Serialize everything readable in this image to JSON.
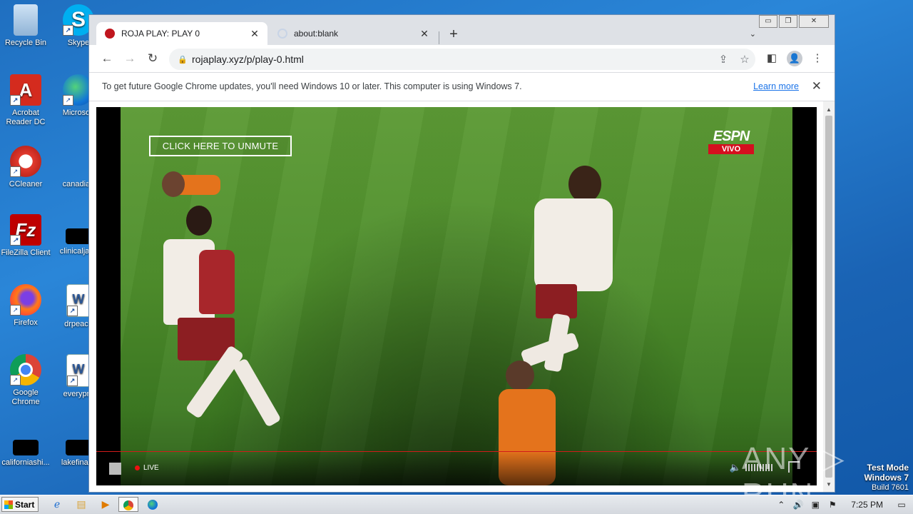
{
  "desktop": {
    "icons": [
      {
        "label": "Recycle Bin"
      },
      {
        "label": "Skype"
      },
      {
        "label": "Acrobat Reader DC"
      },
      {
        "label": "Microsoft"
      },
      {
        "label": "CCleaner"
      },
      {
        "label": "canadian"
      },
      {
        "label": "FileZilla Client"
      },
      {
        "label": "clinicaljack"
      },
      {
        "label": "Firefox"
      },
      {
        "label": "drpeace"
      },
      {
        "label": "Google Chrome"
      },
      {
        "label": "everypre"
      },
      {
        "label": "californiashi..."
      },
      {
        "label": "lakefinally"
      }
    ]
  },
  "browser": {
    "tabs": [
      {
        "title": "ROJA PLAY: PLAY 0",
        "close": "✕"
      },
      {
        "title": "about:blank",
        "close": "✕"
      }
    ],
    "new_tab": "+",
    "tab_search": "⌄",
    "nav": {
      "back": "←",
      "forward": "→",
      "reload": "↻"
    },
    "omnibox": {
      "url": "rojaplay.xyz/p/play-0.html",
      "lock": "🔒"
    },
    "window_controls": {
      "minimize": "▭",
      "restore": "❐",
      "close": "✕"
    }
  },
  "infobar": {
    "message": "To get future Google Chrome updates, you'll need Windows 10 or later. This computer is using Windows 7.",
    "link": "Learn more",
    "close": "✕"
  },
  "player": {
    "unmute_label": "CLICK HERE TO UNMUTE",
    "broadcaster": "ESPN",
    "broadcaster_tag": "VIVO",
    "live_label": "LIVE",
    "progress": 1.0
  },
  "watermark": {
    "brand": "ANY ▷ RUN",
    "test_mode": "Test Mode",
    "os": "Windows 7",
    "build": "Build 7601"
  },
  "taskbar": {
    "start_label": "Start",
    "clock": "7:25 PM"
  }
}
